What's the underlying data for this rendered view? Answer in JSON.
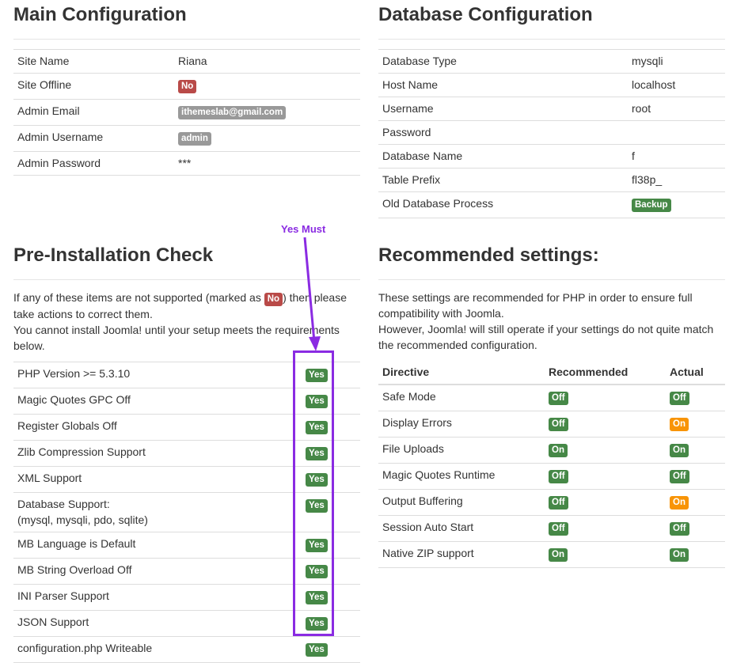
{
  "main_config": {
    "title": "Main Configuration",
    "rows": [
      {
        "label": "Site Name",
        "value": "Riana",
        "badge": ""
      },
      {
        "label": "Site Offline",
        "value": "No",
        "badge": "important"
      },
      {
        "label": "Admin Email",
        "value": "ithemeslab@gmail.com",
        "badge": "default"
      },
      {
        "label": "Admin Username",
        "value": "admin",
        "badge": "default"
      },
      {
        "label": "Admin Password",
        "value": "***",
        "badge": ""
      }
    ]
  },
  "db_config": {
    "title": "Database Configuration",
    "rows": [
      {
        "label": "Database Type",
        "value": "mysqli",
        "badge": ""
      },
      {
        "label": "Host Name",
        "value": "localhost",
        "badge": ""
      },
      {
        "label": "Username",
        "value": "root",
        "badge": ""
      },
      {
        "label": "Password",
        "value": "",
        "badge": ""
      },
      {
        "label": "Database Name",
        "value": "f",
        "badge": ""
      },
      {
        "label": "Table Prefix",
        "value": "fl38p_",
        "badge": ""
      },
      {
        "label": "Old Database Process",
        "value": "Backup",
        "badge": "success"
      }
    ]
  },
  "pre_install": {
    "title": "Pre-Installation Check",
    "intro_before": "If any of these items are not supported (marked as ",
    "intro_badge": "No",
    "intro_after": ") then please take actions to correct them.",
    "intro_line2": "You cannot install Joomla! until your setup meets the requirements below.",
    "rows": [
      {
        "label": "PHP Version >= 5.3.10",
        "sublabel": "",
        "value": "Yes"
      },
      {
        "label": "Magic Quotes GPC Off",
        "sublabel": "",
        "value": "Yes"
      },
      {
        "label": "Register Globals Off",
        "sublabel": "",
        "value": "Yes"
      },
      {
        "label": "Zlib Compression Support",
        "sublabel": "",
        "value": "Yes"
      },
      {
        "label": "XML Support",
        "sublabel": "",
        "value": "Yes"
      },
      {
        "label": "Database Support:",
        "sublabel": "(mysql, mysqli, pdo, sqlite)",
        "value": "Yes"
      },
      {
        "label": "MB Language is Default",
        "sublabel": "",
        "value": "Yes"
      },
      {
        "label": "MB String Overload Off",
        "sublabel": "",
        "value": "Yes"
      },
      {
        "label": "INI Parser Support",
        "sublabel": "",
        "value": "Yes"
      },
      {
        "label": "JSON Support",
        "sublabel": "",
        "value": "Yes"
      },
      {
        "label": "configuration.php Writeable",
        "sublabel": "",
        "value": "Yes"
      }
    ]
  },
  "recommended": {
    "title": "Recommended settings:",
    "intro_line1": "These settings are recommended for PHP in order to ensure full compatibility with Joomla.",
    "intro_line2": "However, Joomla! will still operate if your settings do not quite match the recommended configuration.",
    "headers": {
      "directive": "Directive",
      "recommended": "Recommended",
      "actual": "Actual"
    },
    "rows": [
      {
        "directive": "Safe Mode",
        "recommended": "Off",
        "actual": "Off",
        "actual_ok": true
      },
      {
        "directive": "Display Errors",
        "recommended": "Off",
        "actual": "On",
        "actual_ok": false
      },
      {
        "directive": "File Uploads",
        "recommended": "On",
        "actual": "On",
        "actual_ok": true
      },
      {
        "directive": "Magic Quotes Runtime",
        "recommended": "Off",
        "actual": "Off",
        "actual_ok": true
      },
      {
        "directive": "Output Buffering",
        "recommended": "Off",
        "actual": "On",
        "actual_ok": false
      },
      {
        "directive": "Session Auto Start",
        "recommended": "Off",
        "actual": "Off",
        "actual_ok": true
      },
      {
        "directive": "Native ZIP support",
        "recommended": "On",
        "actual": "On",
        "actual_ok": true
      }
    ]
  },
  "annotation": {
    "text": "Yes Must",
    "color": "#8a2be2"
  },
  "colors": {
    "important": "#b94a48",
    "default": "#999999",
    "success": "#468847",
    "warning": "#f89406"
  }
}
